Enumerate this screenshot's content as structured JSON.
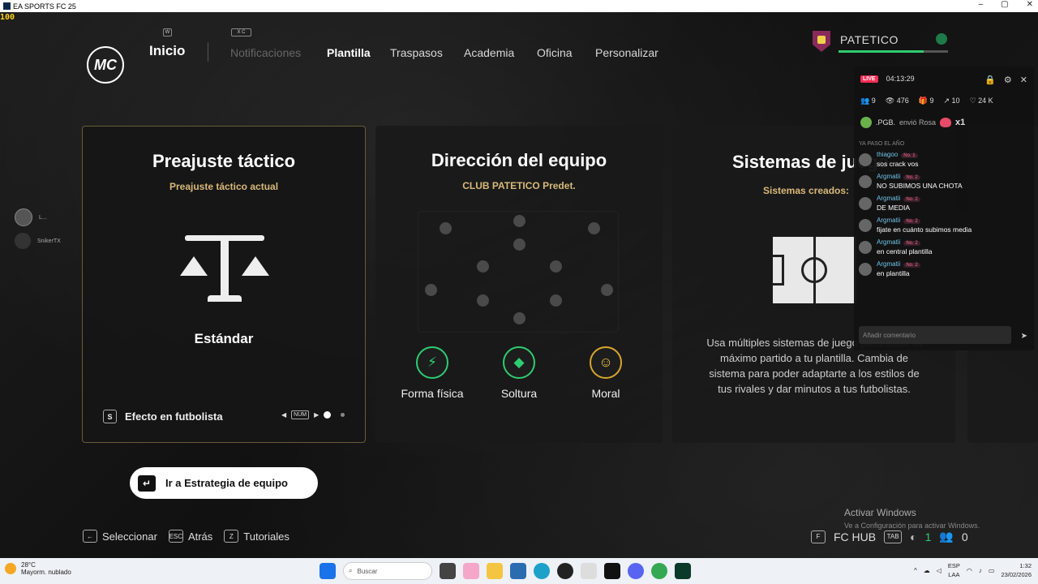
{
  "window": {
    "title": "EA SPORTS FC 25",
    "fps": "100"
  },
  "nav": {
    "logo": "MC",
    "items": [
      {
        "label": "Inicio",
        "key": "W"
      },
      {
        "label": "Notificaciones",
        "key": "X C"
      },
      {
        "label": "Plantilla"
      },
      {
        "label": "Traspasos"
      },
      {
        "label": "Academia"
      },
      {
        "label": "Oficina"
      },
      {
        "label": "Personalizar"
      }
    ]
  },
  "profile": {
    "name": "PATETICO"
  },
  "cards": {
    "tactic": {
      "title": "Preajuste táctico",
      "subtitle": "Preajuste táctico actual",
      "value": "Estándar",
      "effect_key": "S",
      "effect_label": "Efecto en futbolista",
      "pager_key": "NUM"
    },
    "team": {
      "title": "Dirección del equipo",
      "subtitle": "CLUB PATETICO Predet.",
      "stats": [
        {
          "label": "Forma física",
          "icon": "lightning-icon"
        },
        {
          "label": "Soltura",
          "icon": "diamond-icon"
        },
        {
          "label": "Moral",
          "icon": "face-icon"
        }
      ]
    },
    "systems": {
      "title": "Sistemas de juego",
      "subtitle": "Sistemas creados:",
      "description": "Usa múltiples sistemas de juego para sacar el máximo partido a tu plantilla. Cambia de sistema para poder adaptarte a los estilos de tus rivales y dar minutos a tus futbolistas."
    }
  },
  "strategy_button": "Ir a Estrategia de equipo",
  "bottom": {
    "select": {
      "key": "←",
      "label": "Seleccionar"
    },
    "back": {
      "key": "ESC",
      "label": "Atrás"
    },
    "tutorials": {
      "key": "Z",
      "label": "Tutoriales"
    },
    "hub_key": "F",
    "hub": "FC HUB",
    "tab_key": "TAB",
    "count_green": "1",
    "count_friends": "0"
  },
  "windows_activation": {
    "title": "Activar Windows",
    "text": "Ve a Configuración para activar Windows."
  },
  "friends": [
    {
      "name": "L..."
    },
    {
      "name": "SnikerTX"
    }
  ],
  "tiktok": {
    "live": "LIVE",
    "time": "04:13:29",
    "stats": {
      "users": "9",
      "views": "476",
      "gifts": "9",
      "shares": "10",
      "likes": "24 K"
    },
    "gift": {
      "user": ".PGB.",
      "text": "envió Rosa",
      "count": "x1"
    },
    "hidden_line": "YA PASO EL AÑO",
    "messages": [
      {
        "user": "thiagoo",
        "badge": "No. 1",
        "text": "sos crack vos"
      },
      {
        "user": "Argmatii",
        "badge": "No. 2",
        "text": "NO SUBIMOS UNA CHOTA"
      },
      {
        "user": "Argmatii",
        "badge": "No. 2",
        "text": "DE MEDIA"
      },
      {
        "user": "Argmatii",
        "badge": "No. 2",
        "text": "fijate en cuánto subimos media"
      },
      {
        "user": "Argmatii",
        "badge": "No. 2",
        "text": "en central plantilla"
      },
      {
        "user": "Argmatii",
        "badge": "No. 2",
        "text": "en plantilla"
      }
    ],
    "input_placeholder": "Añadir comentario"
  },
  "taskbar": {
    "temp": "28°C",
    "weather": "Mayorm. nublado",
    "search": "Buscar",
    "lang1": "ESP",
    "lang2": "LAA",
    "time": "1:32",
    "date": "23/02/2026"
  }
}
